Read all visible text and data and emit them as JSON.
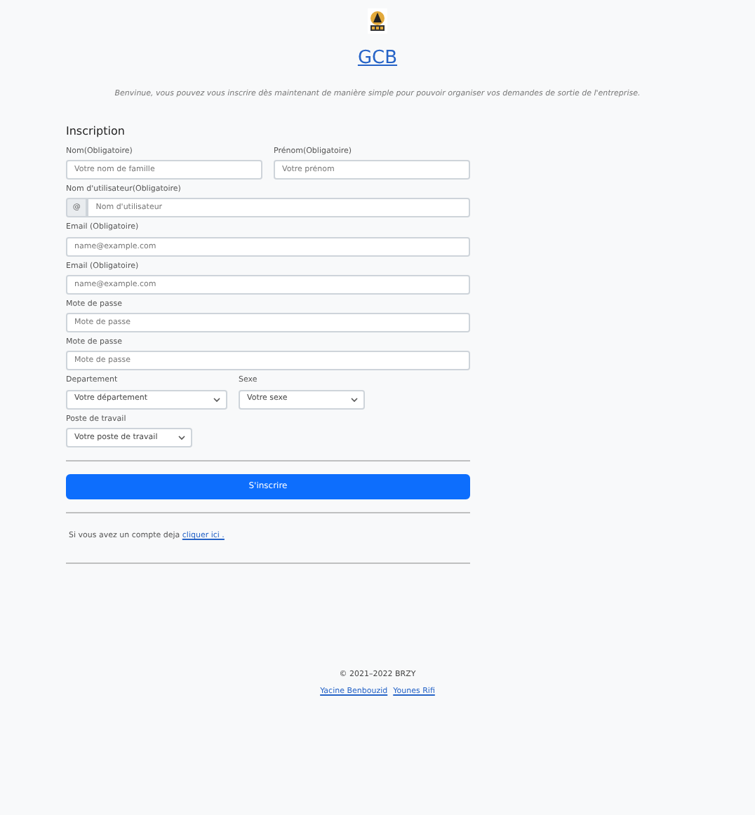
{
  "brand": {
    "title": "GCB",
    "subtitle": "Benvinue, vous pouvez vous inscrire dès maintenant de manière simple pour pouvoir organiser vos demandes de sortie de l'entreprise."
  },
  "form": {
    "heading": "Inscription",
    "rows": [
      {
        "fields": [
          {
            "kind": "text",
            "label": "Nom(Obligatoire)",
            "placeholder": "Votre nom de famille"
          },
          {
            "kind": "text",
            "label": "Prénom(Obligatoire)",
            "placeholder": "Votre prénom"
          }
        ]
      },
      {
        "fields": [
          {
            "kind": "group",
            "label": "Nom d'utilisateur(Obligatoire)",
            "prefix": "@",
            "placeholder": "Nom d'utilisateur"
          }
        ]
      },
      {
        "fields": [
          {
            "kind": "text",
            "label": "Email (Obligatoire)",
            "placeholder": "name@example.com"
          }
        ]
      },
      {
        "fields": [
          {
            "kind": "text",
            "label": "Email (Obligatoire)",
            "placeholder": "name@example.com"
          }
        ]
      },
      {
        "fields": [
          {
            "kind": "text",
            "label": "Mote de passe",
            "placeholder": "Mote de passe"
          }
        ]
      },
      {
        "fields": [
          {
            "kind": "text",
            "label": "Mote de passe",
            "placeholder": "Mote de passe"
          }
        ]
      },
      {
        "fields": [
          {
            "kind": "select",
            "label": "Departement",
            "value": "Votre département"
          },
          {
            "kind": "select",
            "label": "Sexe",
            "value": "Votre sexe"
          }
        ]
      },
      {
        "fields": [
          {
            "kind": "select",
            "label": "Poste de travail",
            "value": "Votre poste de travail"
          }
        ]
      }
    ],
    "submit": "S'inscrire",
    "login_text": "Si vous avez un compte deja",
    "login_link": "cliquer ici ."
  },
  "footer": {
    "copyright": "© 2021–2022 BRZY",
    "links": [
      "Yacine Benbouzid",
      "Younes Rifi"
    ]
  }
}
